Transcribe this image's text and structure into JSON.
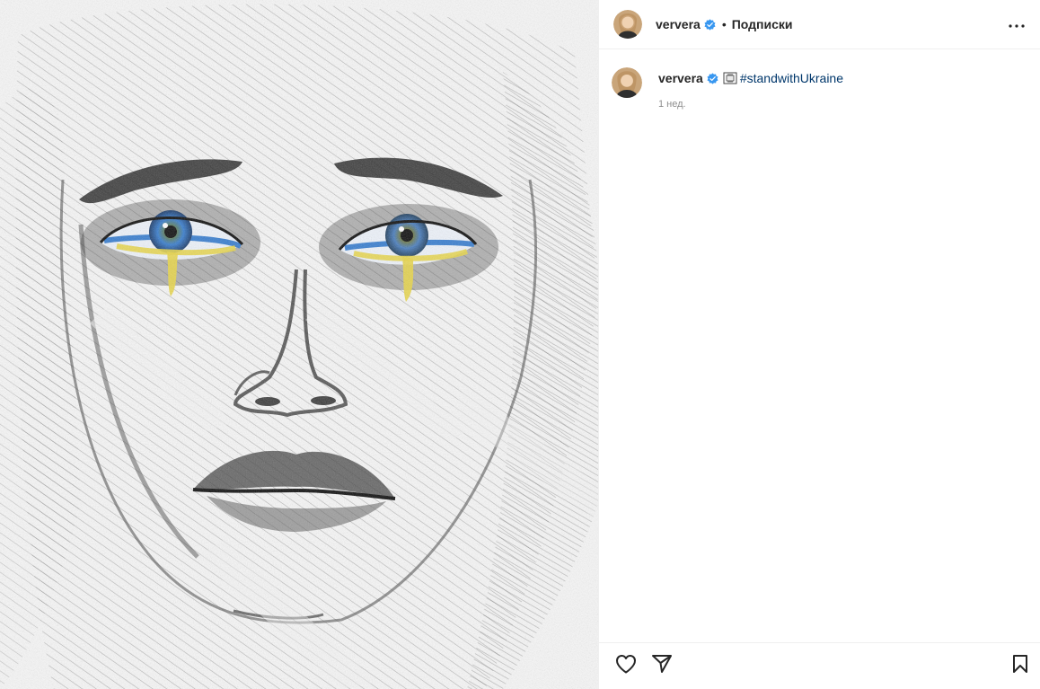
{
  "post": {
    "image_alt": "Pencil sketch portrait of a crying face with blue and yellow eyes",
    "author": {
      "username": "ververa",
      "verified": true
    },
    "header": {
      "separator": "•",
      "follow_label": "Подписки",
      "more_icon": "more-horizontal-icon"
    },
    "caption": {
      "username": "ververa",
      "emoji": "flag-emoji",
      "hashtag": "#standwithUkraine",
      "time": "1 нед."
    },
    "actions": {
      "like_icon": "heart-icon",
      "share_icon": "paper-plane-icon",
      "save_icon": "bookmark-icon"
    }
  },
  "colors": {
    "verified_blue": "#3897f0",
    "hashtag": "#00376b",
    "muted": "#8e8e8e",
    "tear_yellow": "#e8d64a",
    "iris_blue": "#3a7fd0"
  }
}
